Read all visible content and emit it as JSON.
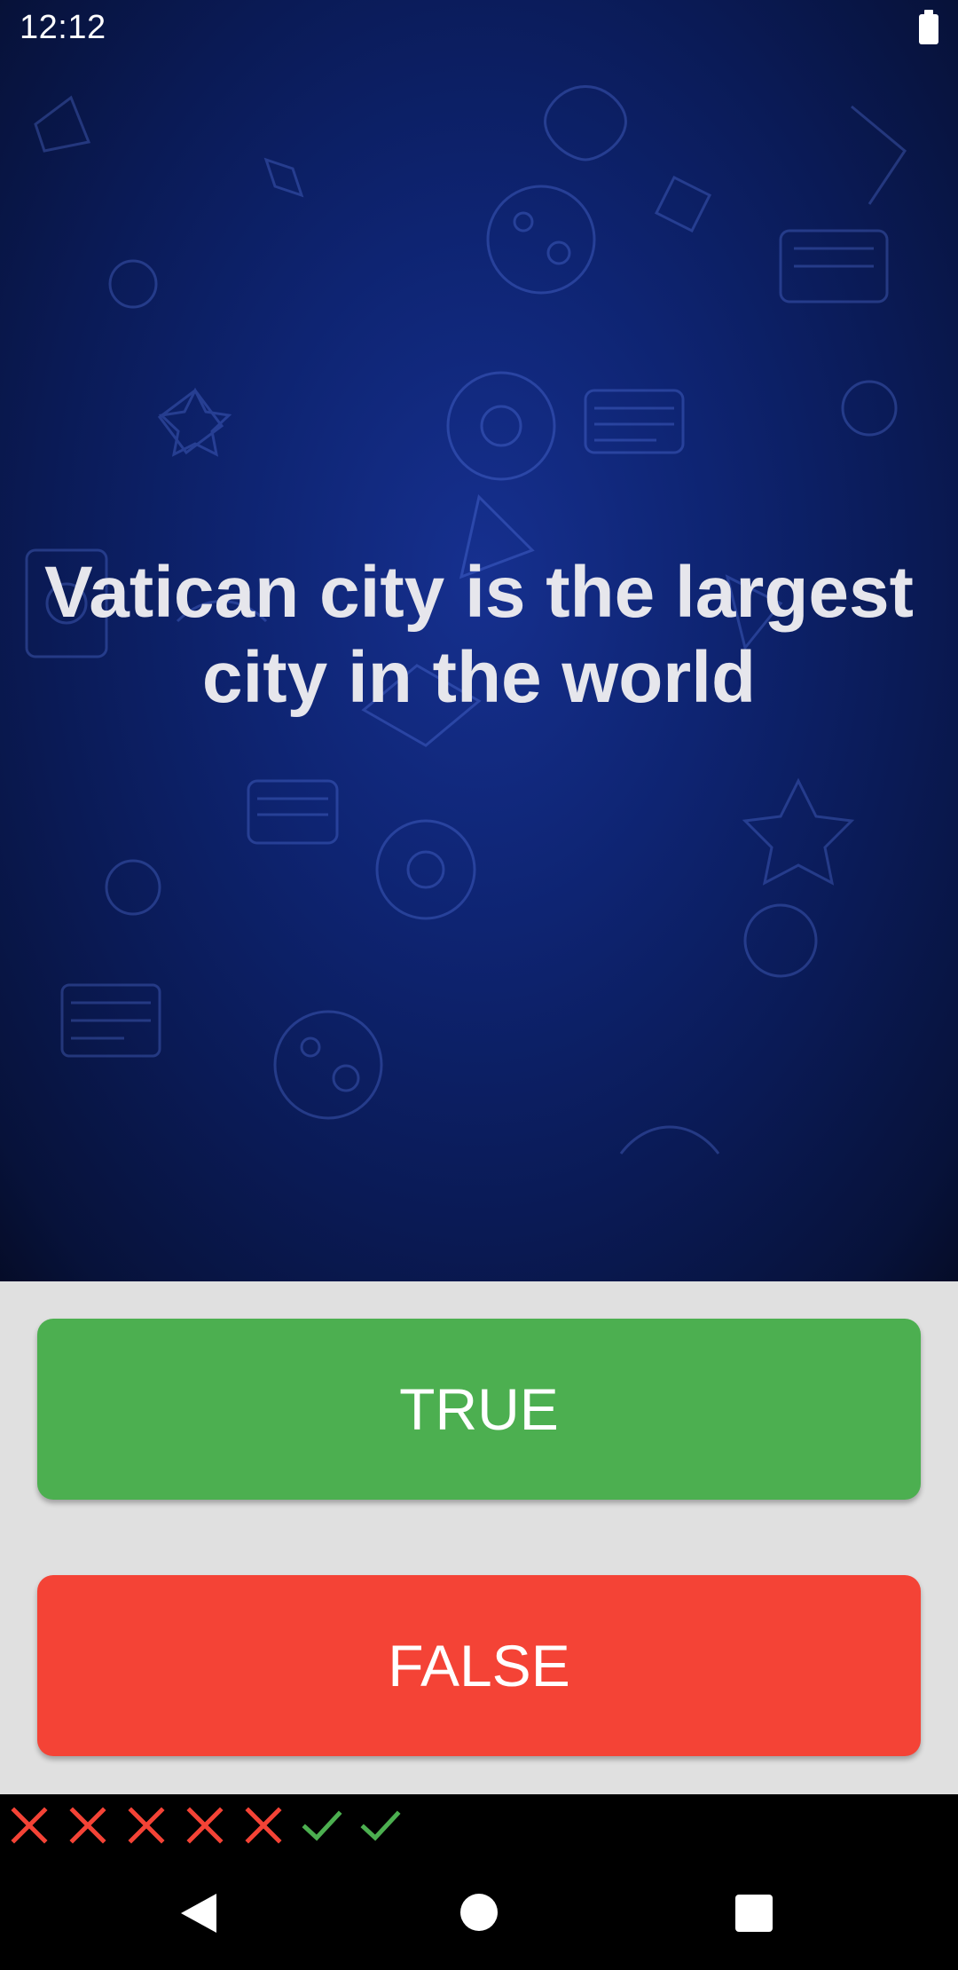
{
  "status": {
    "time": "12:12"
  },
  "question": {
    "text": "Vatican city is the largest city in the world"
  },
  "buttons": {
    "true_label": "TRUE",
    "false_label": "FALSE"
  },
  "score": {
    "results": [
      "wrong",
      "wrong",
      "wrong",
      "wrong",
      "wrong",
      "correct",
      "correct"
    ]
  },
  "colors": {
    "true_button": "#4caf50",
    "false_button": "#f44336",
    "panel": "#e0e0e0",
    "hero": "#0e2472"
  }
}
